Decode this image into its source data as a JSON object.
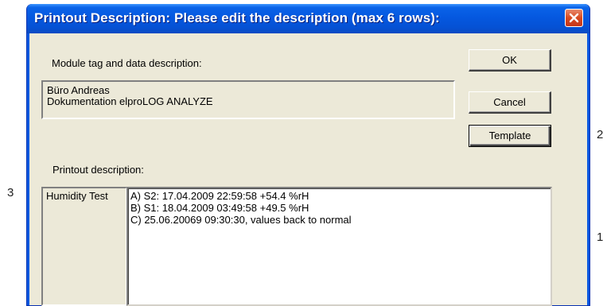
{
  "dialog": {
    "title": "Printout Description: Please edit the description (max 6 rows):",
    "close_icon": "close-icon"
  },
  "module": {
    "label": "Module tag and data description:",
    "lines": [
      "Büro Andreas",
      "Dokumentation elproLOG ANALYZE"
    ]
  },
  "buttons": {
    "ok": "OK",
    "cancel": "Cancel",
    "template": "Template"
  },
  "printout": {
    "label": "Printout description:",
    "side_label": "Humidity Test",
    "lines": [
      "A) S2: 17.04.2009 22:59:58 +54.4 %rH",
      "B) S1: 18.04.2009 03:49:58 +49.5 %rH",
      "C) 25.06.20069 09:30:30, values back to normal"
    ]
  },
  "callouts": {
    "one": "1",
    "two": "2",
    "three": "3"
  },
  "colors": {
    "titlebar": "#0558e0",
    "dialog_background": "#ece9d8",
    "close_button": "#d8491f"
  }
}
